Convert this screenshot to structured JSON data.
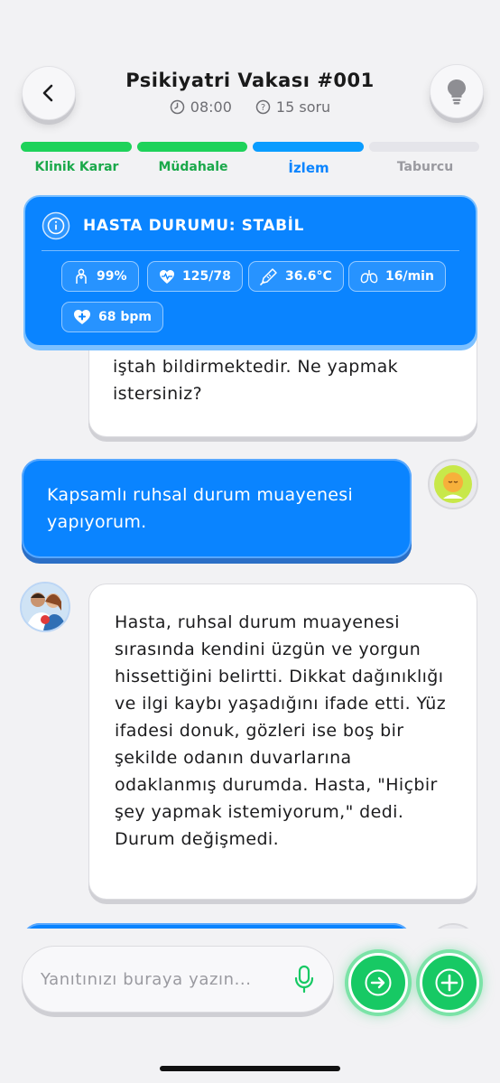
{
  "header": {
    "title": "Psikiyatri Vakası #001",
    "time": "08:00",
    "questions": "15 soru"
  },
  "steps": [
    {
      "label": "Klinik Karar",
      "state": "done"
    },
    {
      "label": "Müdahale",
      "state": "done"
    },
    {
      "label": "İzlem",
      "state": "active"
    },
    {
      "label": "Taburcu",
      "state": "pending"
    }
  ],
  "status": {
    "title": "HASTA DURUMU: STABİL",
    "vitals": {
      "spo2": "99%",
      "bp": "125/78",
      "temp": "36.6°C",
      "resp": "16/min",
      "hr": "68 bpm"
    }
  },
  "messages": [
    {
      "from": "assistant",
      "text": "iştah bildirmektedir. Ne yapmak istersiniz?"
    },
    {
      "from": "user",
      "text": "Kapsamlı ruhsal durum muayenesi yapıyorum."
    },
    {
      "from": "assistant",
      "text": "Hasta, ruhsal durum muayenesi sırasında kendini üzgün ve yorgun hissettiğini belirtti. Dikkat dağınıklığı ve ilgi kaybı yaşadığını ifade etti. Yüz ifadesi donuk, gözleri ise boş bir şekilde odanın duvarlarına odaklanmış durumda. Hasta, \"Hiçbir şey yapmak istemiyorum,\" dedi. Durum değişmedi."
    }
  ],
  "input": {
    "placeholder": "Yanıtınızı buraya yazın...",
    "value": ""
  },
  "colors": {
    "done": "#1ed25a",
    "active": "#0a84ff",
    "pending": "#e5e5ea",
    "accent_green": "#17c964"
  },
  "icons": {
    "back": "chevron-left-icon",
    "hint": "lightbulb-icon",
    "clock": "clock-icon",
    "question": "question-circle-icon",
    "info": "info-icon",
    "mic": "microphone-icon",
    "send": "arrow-right-icon",
    "add": "plus-icon"
  }
}
